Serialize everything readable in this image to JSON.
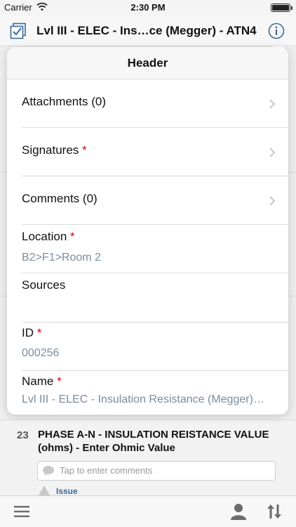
{
  "status_bar": {
    "carrier": "Carrier",
    "time": "2:30 PM",
    "battery_level": 1.0
  },
  "nav": {
    "title": "Lvl III - ELEC - Ins…ce (Megger) - ATN4",
    "left_icon": "checklist-icon",
    "right_icon": "info-icon"
  },
  "popover": {
    "title": "Header",
    "rows": [
      {
        "label": "Attachments (0)",
        "required": false,
        "chevron": true
      },
      {
        "label": "Signatures",
        "required": true,
        "chevron": true
      },
      {
        "label": "Comments (0)",
        "required": false,
        "chevron": true
      },
      {
        "label": "Location",
        "required": true,
        "value": "B2>F1>Room 2"
      },
      {
        "label": "Sources",
        "required": false,
        "value": ""
      },
      {
        "label": "ID",
        "required": true,
        "value": "000256"
      },
      {
        "label": "Name",
        "required": true,
        "value": "Lvl III - ELEC - Insulation Resistance (Megger)…"
      }
    ],
    "required_marker": "*"
  },
  "background_item": {
    "number": "23",
    "title": "PHASE A-N - INSULATION REISTANCE VALUE (ohms) - Enter Ohmic Value",
    "comment_placeholder": "Tap to enter comments",
    "issue_label": "Issue"
  },
  "toolbar": {
    "icons": [
      "menu-icon",
      "user-icon",
      "sort-icon"
    ]
  },
  "colors": {
    "accent": "#3a6a9a",
    "required": "#d0021b",
    "value_text": "#7a8da0"
  }
}
